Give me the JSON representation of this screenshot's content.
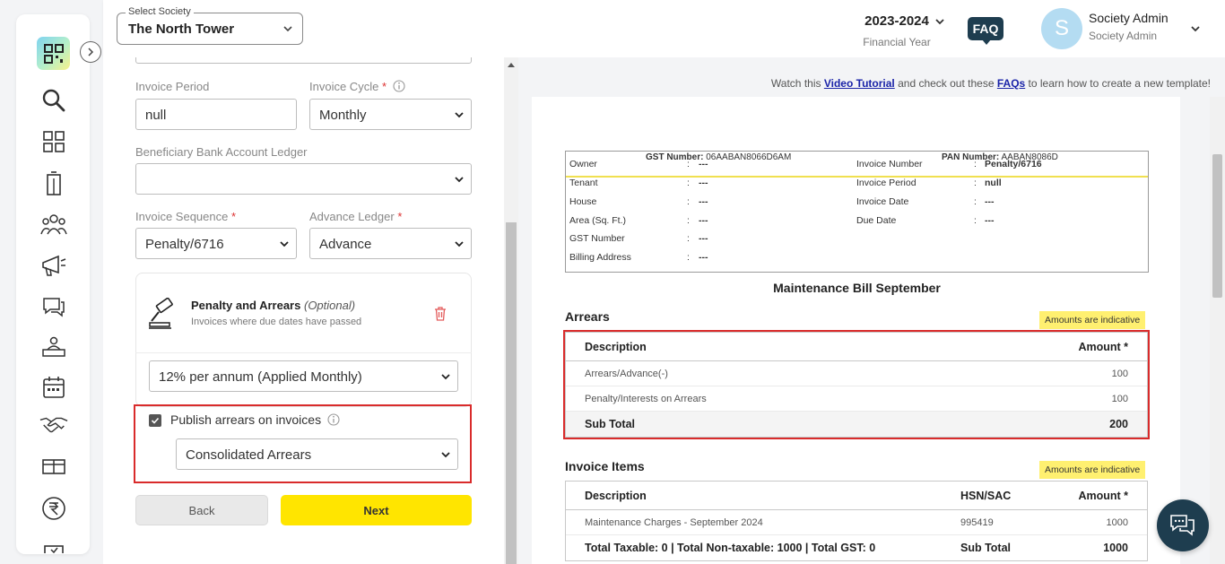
{
  "header": {
    "society_label": "Select Society",
    "society_value": "The North Tower",
    "financial_year": "2023-2024",
    "financial_year_label": "Financial Year",
    "faq_label": "FAQ",
    "avatar_initial": "S",
    "user_name": "Society Admin",
    "user_role": "Society Admin"
  },
  "sidebar": {
    "icons": [
      "search-icon",
      "dashboard-icon",
      "building-icon",
      "members-icon",
      "announcement-icon",
      "chat-icon",
      "helpdesk-icon",
      "calendar-icon",
      "handshake-icon",
      "amenities-icon",
      "rupee-icon"
    ]
  },
  "form": {
    "invoice_period_label": "Invoice Period",
    "invoice_period_value": "null",
    "invoice_cycle_label": "Invoice Cycle",
    "invoice_cycle_value": "Monthly",
    "bank_ledger_label": "Beneficiary Bank Account Ledger",
    "bank_ledger_value": "",
    "invoice_sequence_label": "Invoice Sequence",
    "invoice_sequence_value": "Penalty/6716",
    "advance_ledger_label": "Advance Ledger",
    "advance_ledger_value": "Advance",
    "required_mark": "*",
    "penalty_title": "Penalty and Arrears",
    "penalty_optional": "(Optional)",
    "penalty_subtitle": "Invoices where due dates have passed",
    "penalty_rate_value": "12% per annum (Applied Monthly)",
    "publish_label": "Publish arrears on invoices",
    "publish_checked": true,
    "arrears_mode_value": "Consolidated Arrears",
    "back_label": "Back",
    "next_label": "Next"
  },
  "preview": {
    "tutorial_prefix": "Watch this",
    "tutorial_link": "Video Tutorial",
    "tutorial_mid": "and check out these",
    "faq_link": "FAQs",
    "tutorial_suffix": "to learn how to create a new template!",
    "gst_label": "GST Number:",
    "gst_value": "06AABAN8066D6AM",
    "pan_label": "PAN Number:",
    "pan_value": "AABAN8086D",
    "info_left": [
      {
        "label": "Owner",
        "value": "---"
      },
      {
        "label": "Tenant",
        "value": "---"
      },
      {
        "label": "House",
        "value": "---"
      },
      {
        "label": "Area (Sq. Ft.)",
        "value": "---"
      },
      {
        "label": "GST Number",
        "value": "---"
      },
      {
        "label": "Billing Address",
        "value": "---"
      }
    ],
    "info_right": [
      {
        "label": "Invoice Number",
        "value": "Penalty/6716"
      },
      {
        "label": "Invoice Period",
        "value": "null"
      },
      {
        "label": "Invoice Date",
        "value": "---"
      },
      {
        "label": "Due Date",
        "value": "---"
      }
    ],
    "colon": ":",
    "bill_title": "Maintenance Bill September",
    "arrears_title": "Arrears",
    "indicative_label": "Amounts are indicative",
    "arrears_table": {
      "col_description": "Description",
      "col_amount": "Amount *",
      "rows": [
        {
          "description": "Arrears/Advance(-)",
          "amount": "100"
        },
        {
          "description": "Penalty/Interests on Arrears",
          "amount": "100"
        }
      ],
      "subtotal_label": "Sub Total",
      "subtotal_value": "200"
    },
    "items_title": "Invoice Items",
    "items_table": {
      "col_description": "Description",
      "col_hsn": "HSN/SAC",
      "col_amount": "Amount *",
      "rows": [
        {
          "description": "Maintenance Charges - September 2024",
          "hsn": "995419",
          "amount": "1000"
        }
      ],
      "totals_label": "Total Taxable: 0 | Total Non-taxable: 1000 | Total GST: 0",
      "subtotal_label": "Sub Total",
      "subtotal_value": "1000"
    }
  },
  "colors": {
    "primary_yellow": "#ffe500",
    "dark_navy": "#1e3d4f",
    "highlight_red": "#d92b2b",
    "indicative_yellow": "#fff070"
  }
}
